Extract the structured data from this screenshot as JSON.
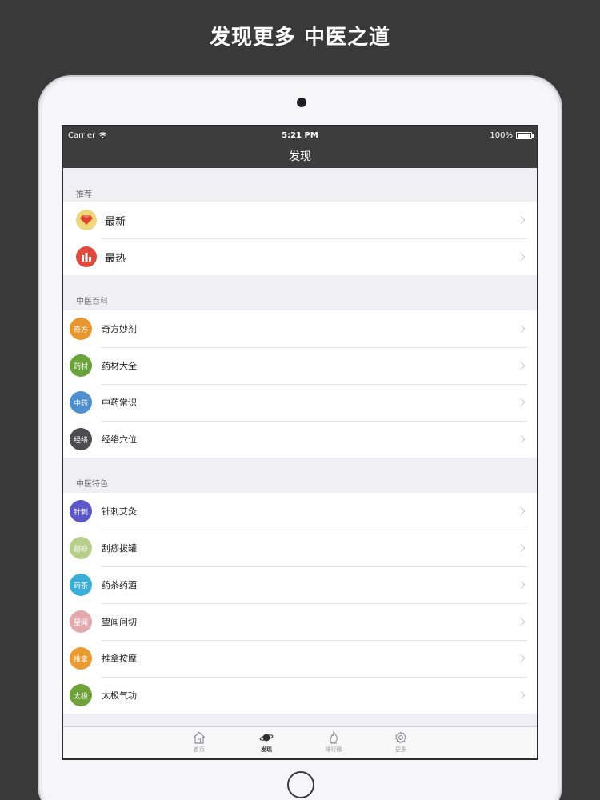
{
  "promo": {
    "title": "发现更多 中医之道"
  },
  "status_bar": {
    "carrier": "Carrier",
    "time": "5:21 PM",
    "battery": "100%"
  },
  "nav": {
    "title": "发现"
  },
  "sections": [
    {
      "header": "推荐",
      "items": [
        {
          "label": "最新",
          "icon": "diamond-icon"
        },
        {
          "label": "最热",
          "icon": "bar-chart-icon"
        }
      ]
    },
    {
      "header": "中医百科",
      "items": [
        {
          "badge": "奇方",
          "label": "奇方妙剂",
          "color": "#e8962f"
        },
        {
          "badge": "药材",
          "label": "药材大全",
          "color": "#6aa33b"
        },
        {
          "badge": "中药",
          "label": "中药常识",
          "color": "#4f8fcf"
        },
        {
          "badge": "经络",
          "label": "经络穴位",
          "color": "#4d4d4f"
        }
      ]
    },
    {
      "header": "中医特色",
      "items": [
        {
          "badge": "针刺",
          "label": "针刺艾灸",
          "color": "#5c57c9"
        },
        {
          "badge": "刮痧",
          "label": "刮痧拔罐",
          "color": "#b8cf8b"
        },
        {
          "badge": "药茶",
          "label": "药茶药酒",
          "color": "#3aaed6"
        },
        {
          "badge": "望闻",
          "label": "望闻问切",
          "color": "#e2a9ae"
        },
        {
          "badge": "推拿",
          "label": "推拿按摩",
          "color": "#eb9a2f"
        },
        {
          "badge": "太极",
          "label": "太极气功",
          "color": "#6fa33a"
        }
      ]
    }
  ],
  "tabs": [
    {
      "label": "首页",
      "icon": "home-icon",
      "active": false
    },
    {
      "label": "发现",
      "icon": "planet-icon",
      "active": true
    },
    {
      "label": "排行榜",
      "icon": "flame-icon",
      "active": false
    },
    {
      "label": "更多",
      "icon": "gear-icon",
      "active": false
    }
  ],
  "colors": {
    "background": "#3a393a",
    "nav_bar": "#3d3d3d",
    "diamond_badge": "#f0d77a",
    "bar_chart_badge": "#e04a3c"
  }
}
